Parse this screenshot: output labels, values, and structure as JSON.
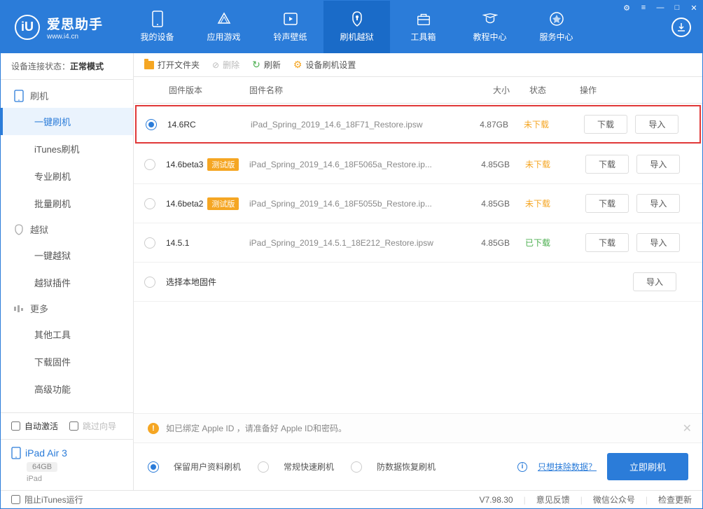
{
  "window_controls": [
    "⚙",
    "≡",
    "—",
    "□",
    "✕"
  ],
  "logo": {
    "title": "爱思助手",
    "url": "www.i4.cn"
  },
  "nav": [
    {
      "label": "我的设备"
    },
    {
      "label": "应用游戏"
    },
    {
      "label": "铃声壁纸"
    },
    {
      "label": "刷机越狱",
      "active": true
    },
    {
      "label": "工具箱"
    },
    {
      "label": "教程中心"
    },
    {
      "label": "服务中心"
    }
  ],
  "sidebar": {
    "status_label": "设备连接状态：",
    "status_value": "正常模式",
    "sections": [
      {
        "title": "刷机",
        "items": [
          "一键刷机",
          "iTunes刷机",
          "专业刷机",
          "批量刷机"
        ],
        "active_index": 0
      },
      {
        "title": "越狱",
        "items": [
          "一键越狱",
          "越狱插件"
        ]
      },
      {
        "title": "更多",
        "items": [
          "其他工具",
          "下载固件",
          "高级功能"
        ]
      }
    ],
    "auto_activate": "自动激活",
    "skip_wizard": "跳过向导",
    "device": {
      "name": "iPad Air 3",
      "storage": "64GB",
      "type": "iPad"
    }
  },
  "toolbar": {
    "open_folder": "打开文件夹",
    "delete": "删除",
    "refresh": "刷新",
    "settings": "设备刷机设置"
  },
  "table": {
    "headers": {
      "version": "固件版本",
      "name": "固件名称",
      "size": "大小",
      "status": "状态",
      "action": "操作"
    },
    "rows": [
      {
        "version": "14.6RC",
        "badge": "",
        "name": "iPad_Spring_2019_14.6_18F71_Restore.ipsw",
        "size": "4.87GB",
        "status": "未下载",
        "status_class": "status-not",
        "selected": true,
        "highlighted": true
      },
      {
        "version": "14.6beta3",
        "badge": "测试版",
        "name": "iPad_Spring_2019_14.6_18F5065a_Restore.ip...",
        "size": "4.85GB",
        "status": "未下载",
        "status_class": "status-not"
      },
      {
        "version": "14.6beta2",
        "badge": "测试版",
        "name": "iPad_Spring_2019_14.6_18F5055b_Restore.ip...",
        "size": "4.85GB",
        "status": "未下载",
        "status_class": "status-not"
      },
      {
        "version": "14.5.1",
        "badge": "",
        "name": "iPad_Spring_2019_14.5.1_18E212_Restore.ipsw",
        "size": "4.85GB",
        "status": "已下载",
        "status_class": "status-done"
      }
    ],
    "local_firmware": "选择本地固件",
    "download_btn": "下载",
    "import_btn": "导入"
  },
  "notice": {
    "text": "如已绑定 Apple ID ，请准备好 Apple ID和密码。"
  },
  "flash": {
    "opt1": "保留用户资料刷机",
    "opt2": "常规快速刷机",
    "opt3": "防数据恢复刷机",
    "erase_link": "只想抹除数据？",
    "flash_btn": "立即刷机"
  },
  "footer": {
    "block_itunes": "阻止iTunes运行",
    "version": "V7.98.30",
    "feedback": "意见反馈",
    "wechat": "微信公众号",
    "check_update": "检查更新"
  }
}
